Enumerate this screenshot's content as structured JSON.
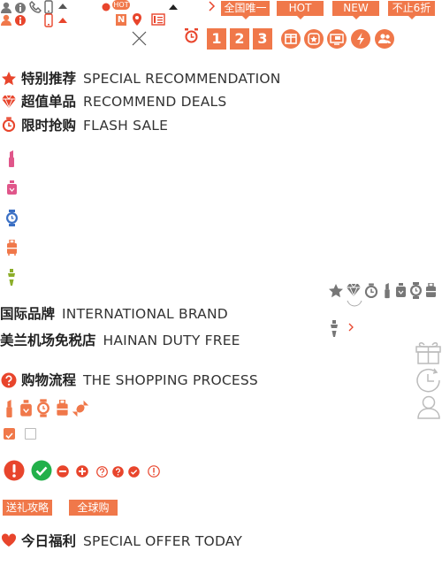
{
  "top_tags": [
    "全国唯一",
    "HOT",
    "NEW",
    "不止6折"
  ],
  "steps": [
    "1",
    "2",
    "3"
  ],
  "hot_badge": "HOT",
  "n_badge": "N",
  "sections": {
    "special": {
      "cn": "特别推荐",
      "en": "SPECIAL RECOMMENDATION"
    },
    "deals": {
      "cn": "超值单品",
      "en": "RECOMMEND DEALS"
    },
    "flash": {
      "cn": "限时抢购",
      "en": "FLASH SALE"
    },
    "intl": {
      "cn": "国际品牌",
      "en": "INTERNATIONAL BRAND"
    },
    "hainan": {
      "cn": "美兰机场免税店",
      "en": "HAINAN DUTY FREE"
    },
    "process": {
      "cn": "购物流程",
      "en": "THE SHOPPING PROCESS"
    },
    "today": {
      "cn": "今日福利",
      "en": "SPECIAL OFFER TODAY"
    }
  },
  "bottom_tags": [
    "送礼攻略",
    "全球购"
  ],
  "colors": {
    "accent": "#f0784a",
    "red": "#e8452c",
    "green": "#22b04a",
    "pink": "#e0568a",
    "blue": "#3a6fc4",
    "olive": "#8cae2a",
    "gray": "#888888"
  }
}
